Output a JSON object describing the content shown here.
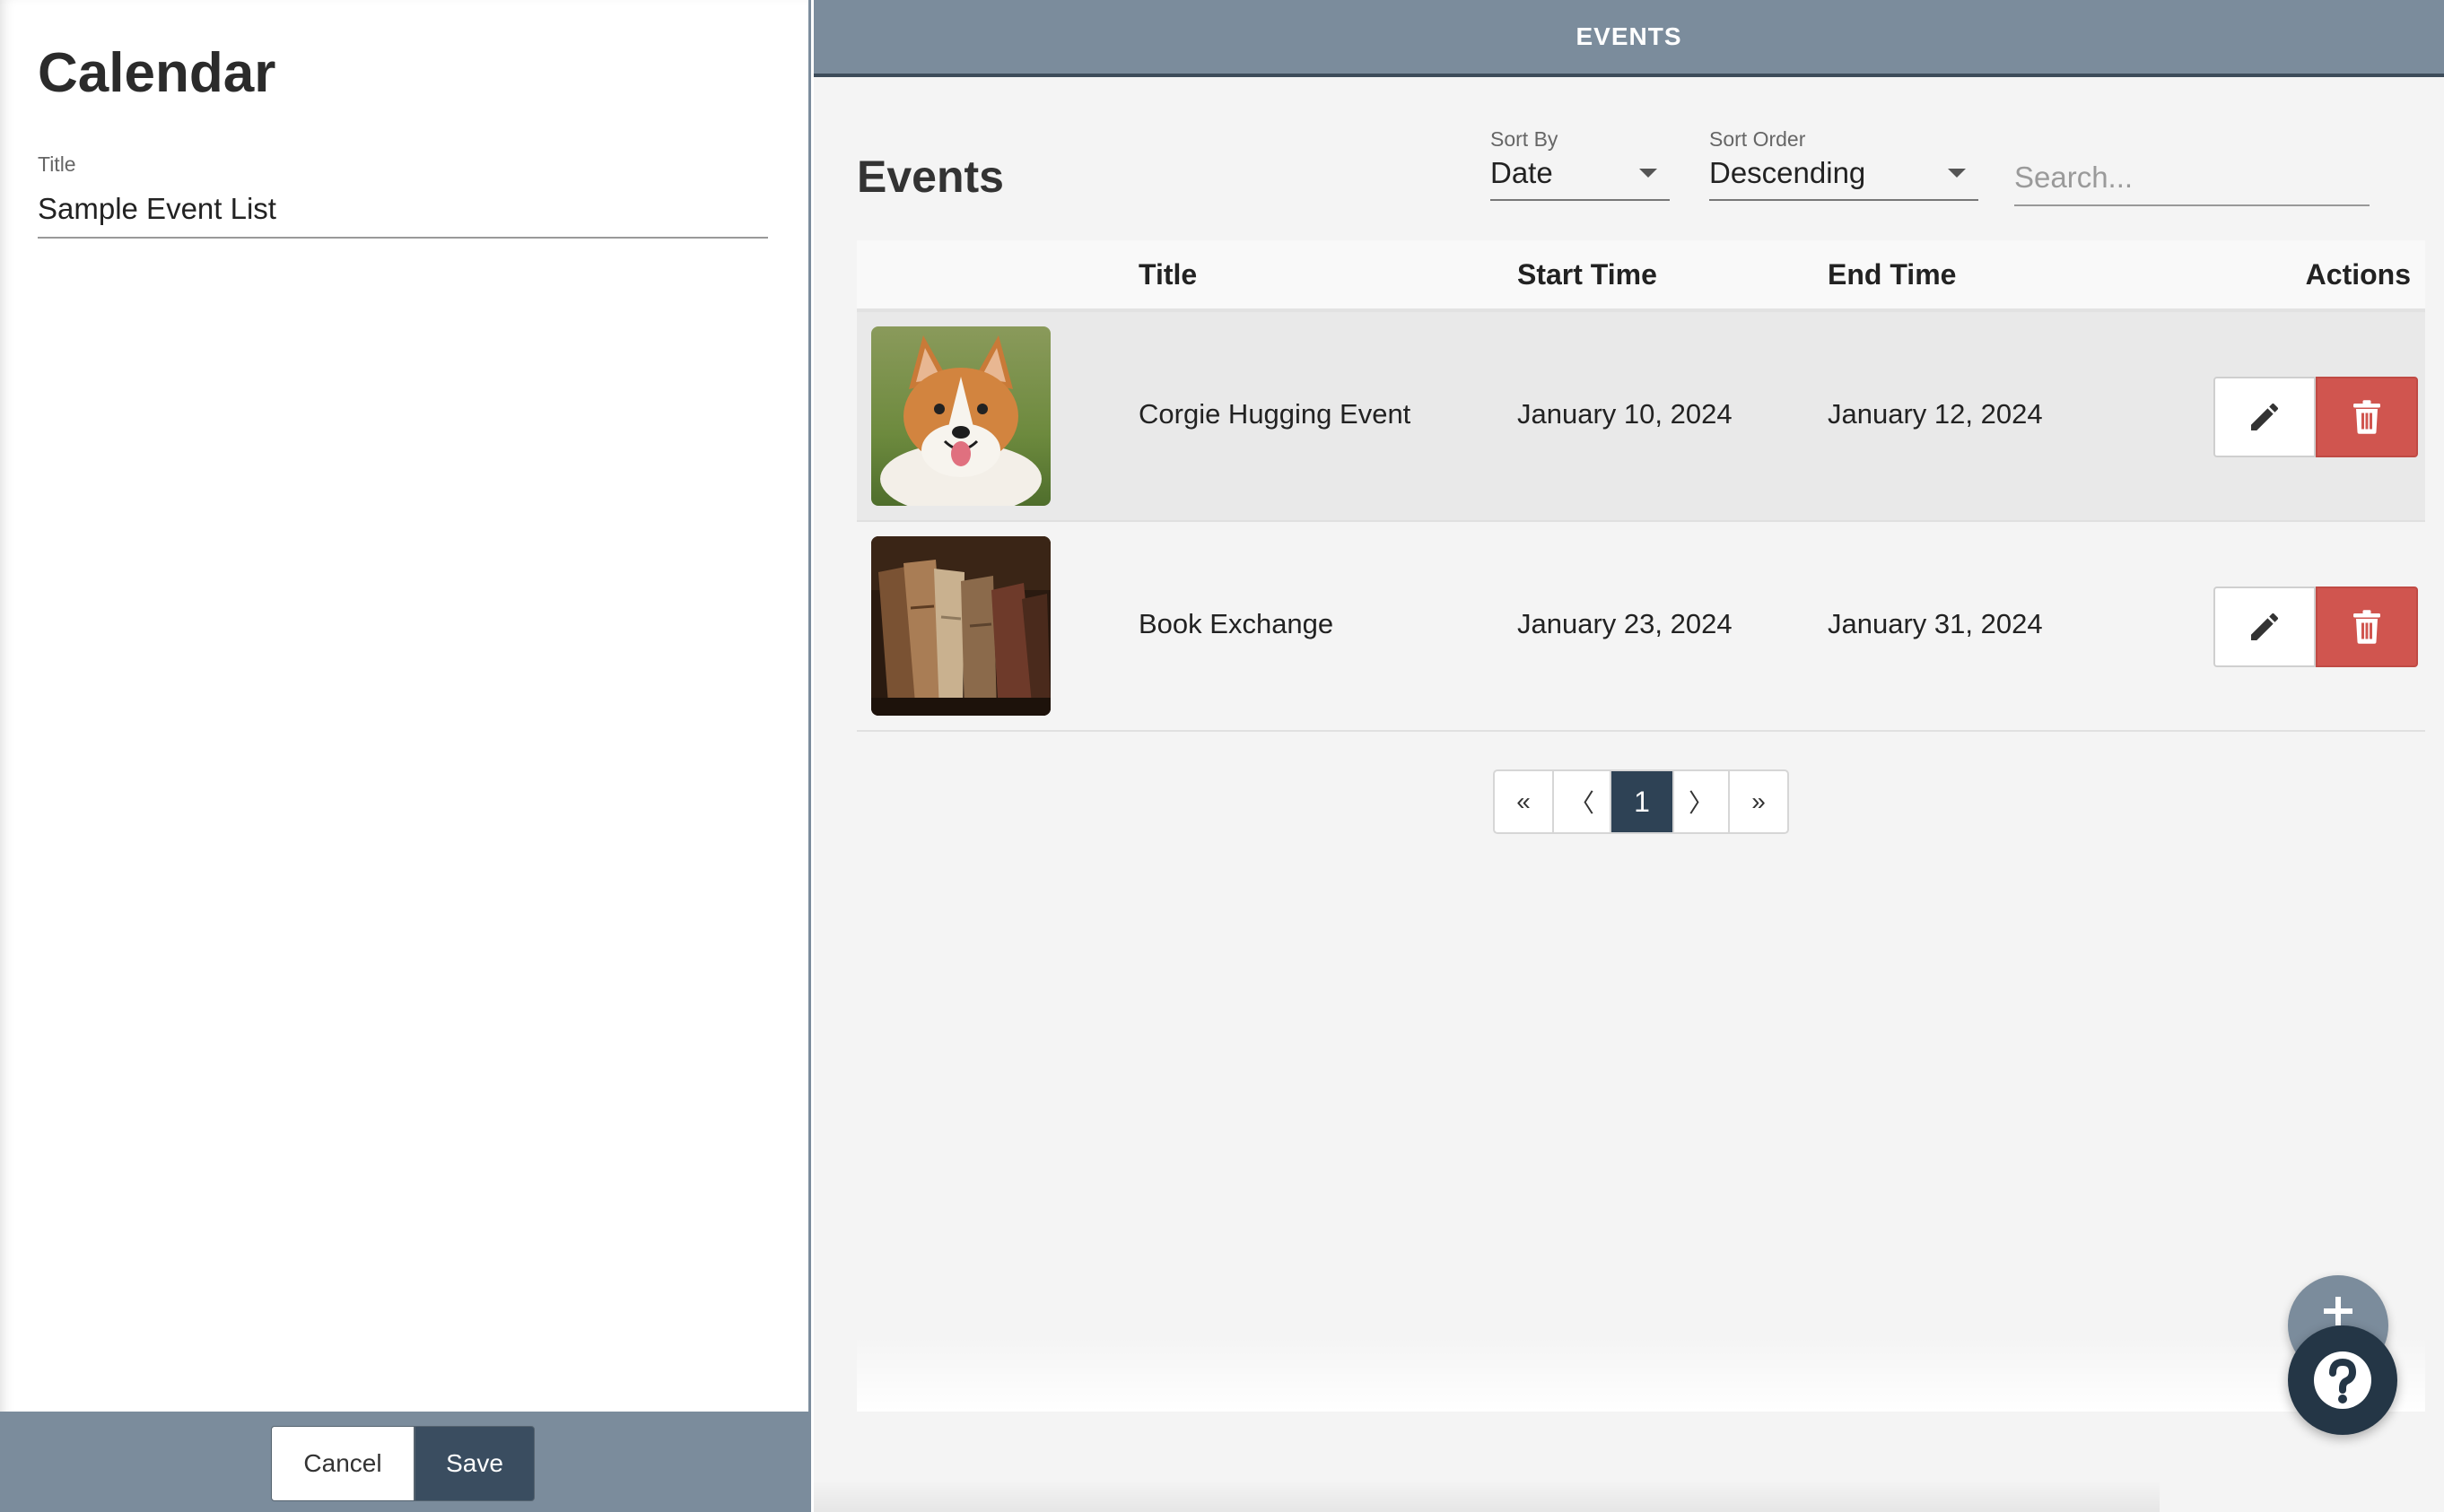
{
  "left_panel": {
    "heading": "Calendar",
    "title_field": {
      "label": "Title",
      "value": "Sample Event List"
    },
    "footer": {
      "cancel_label": "Cancel",
      "save_label": "Save"
    }
  },
  "top_bar": {
    "title": "EVENTS"
  },
  "events": {
    "heading": "Events",
    "sort_by": {
      "label": "Sort By",
      "value": "Date"
    },
    "sort_order": {
      "label": "Sort Order",
      "value": "Descending"
    },
    "search": {
      "placeholder": "Search..."
    },
    "columns": [
      "",
      "Title",
      "Start Time",
      "End Time",
      "Actions"
    ],
    "rows": [
      {
        "image": "corgi-photo",
        "title": "Corgie Hugging Event",
        "start": "January 10, 2024",
        "end": "January 12, 2024"
      },
      {
        "image": "old-books-photo",
        "title": "Book Exchange",
        "start": "January 23, 2024",
        "end": "January 31, 2024"
      }
    ],
    "pagination": {
      "first": "«",
      "prev": "〈",
      "current": "1",
      "next": "〉",
      "last": "»"
    }
  },
  "fab": {
    "add_icon": "plus-icon",
    "help_icon": "help-icon"
  },
  "colors": {
    "header_bg": "#7b8c9c",
    "primary_dark": "#3a4d60",
    "delete_red": "#d0554f",
    "page_bg": "#f4f4f4"
  }
}
